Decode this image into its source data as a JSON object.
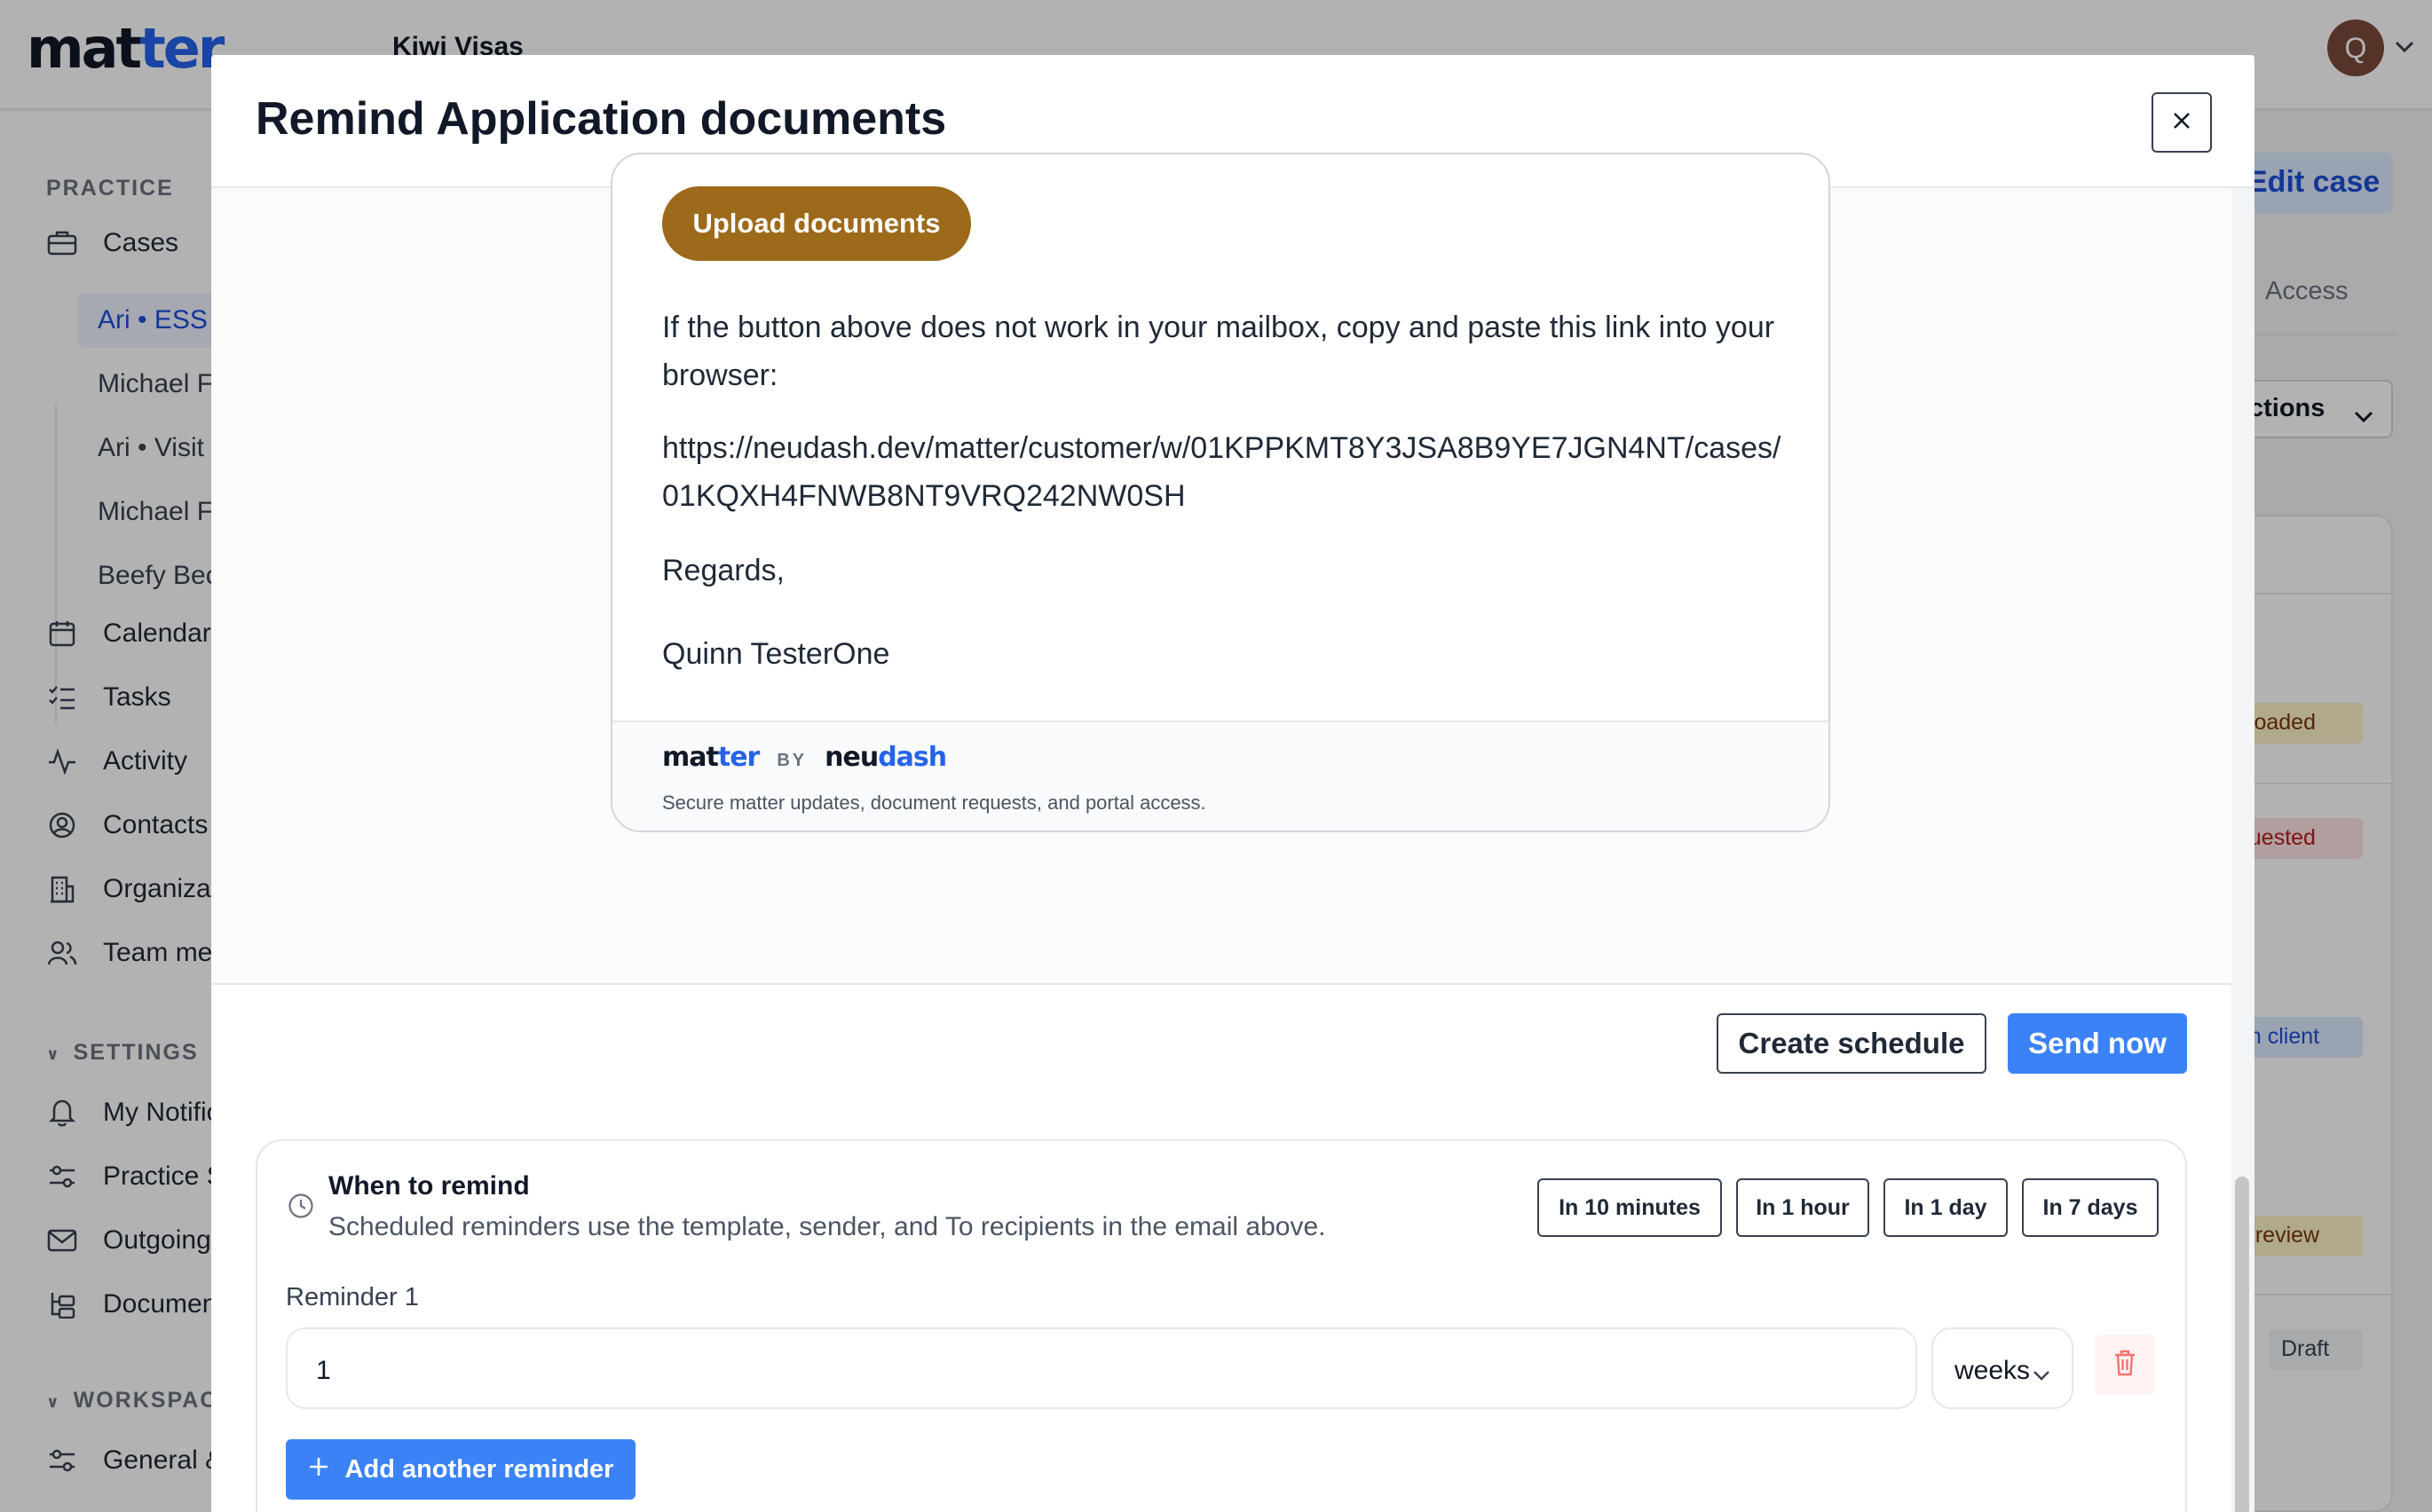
{
  "app": {
    "logo_main": "mat",
    "logo_accent": "ter",
    "case_header": "Kiwi Visas",
    "avatar_initial": "Q"
  },
  "sidebar": {
    "practice_label": "PRACTICE",
    "settings_label": "SETTINGS",
    "workspace_label": "WORKSPACE",
    "cases": "Cases",
    "case_items": [
      "Ari • ESS",
      "Michael F",
      "Ari • Visit",
      "Michael F",
      "Beefy Bec"
    ],
    "calendar": "Calendar",
    "tasks": "Tasks",
    "activity": "Activity",
    "contacts": "Contacts",
    "organizations": "Organizat",
    "team": "Team me",
    "notifications": "My Notific",
    "practice_settings": "Practice S",
    "outgoing": "Outgoing",
    "documents": "Documen",
    "general": "General &"
  },
  "main": {
    "edit_case": "Edit case",
    "access_tab": "Access",
    "actions": "ctions",
    "badges": [
      "ploaded",
      "quested",
      "on client",
      "g review",
      "Draft"
    ]
  },
  "modal": {
    "title": "Remind Application documents",
    "email": {
      "upload_button": "Upload documents",
      "fallback_text": "If the button above does not work in your mailbox, copy and paste this link into your browser:",
      "link_line1": "https://neudash.dev/matter/customer/w/01KPPKMT8Y3JSA8B9YE7JGN4NT/cases/",
      "link_line2": "01KQXH4FNWB8NT9VRQ242NW0SH",
      "regards": "Regards,",
      "signature": "Quinn TesterOne",
      "footer_brand_a": "mat",
      "footer_brand_a_accent": "ter",
      "footer_by": "BY",
      "footer_brand_b": "neu",
      "footer_brand_b_accent": "dash",
      "footer_desc": "Secure matter updates, document requests, and portal access."
    },
    "create_schedule": "Create schedule",
    "send_now": "Send now",
    "reminders": {
      "title": "When to remind",
      "subtitle": "Scheduled reminders use the template, sender, and To recipients in the email above.",
      "quick_options": [
        "In 10 minutes",
        "In 1 hour",
        "In 1 day",
        "In 7 days"
      ],
      "reminder_label": "Reminder 1",
      "amount": "1",
      "unit": "weeks",
      "add_button": "Add another reminder"
    }
  },
  "colors": {
    "primary": "#3b82f6",
    "upload_button": "#9c6a1a",
    "brand_accent": "#2563eb",
    "danger": "#ef4444"
  }
}
